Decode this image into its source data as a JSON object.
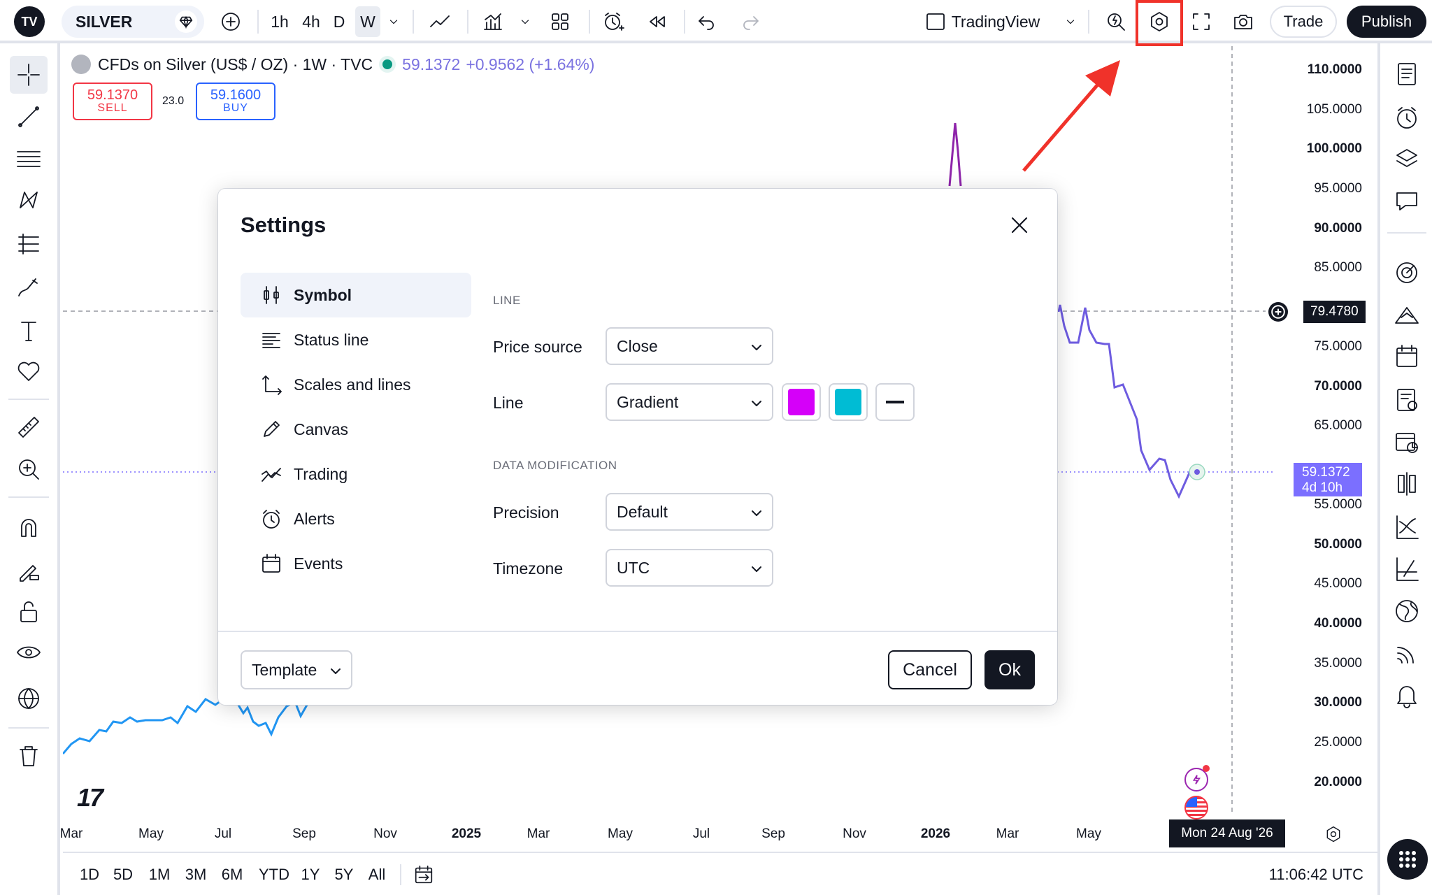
{
  "header": {
    "symbol": "SILVER",
    "timeframes": [
      "1h",
      "4h",
      "D",
      "W"
    ],
    "active_timeframe": "W",
    "layout_name": "TradingView",
    "trade_label": "Trade",
    "publish_label": "Publish",
    "logo_text": "TV"
  },
  "legend": {
    "title": "CFDs on Silver (US$ / OZ) · 1W · TVC",
    "last": "59.1372",
    "change": "+0.9562 (+1.64%)",
    "sell_price": "59.1370",
    "sell_label": "SELL",
    "spread": "23.0",
    "buy_price": "59.1600",
    "buy_label": "BUY"
  },
  "price_axis": {
    "labels": [
      "110.0000",
      "105.0000",
      "100.0000",
      "95.0000",
      "90.0000",
      "85.0000",
      "75.0000",
      "70.0000",
      "65.0000",
      "55.0000",
      "50.0000",
      "45.0000",
      "40.0000",
      "35.0000",
      "30.0000",
      "25.0000",
      "20.0000"
    ],
    "crosshair_price": "79.4780",
    "last_price": "59.1372",
    "countdown": "4d 10h"
  },
  "time_axis": {
    "labels": [
      "Mar",
      "May",
      "Jul",
      "Sep",
      "Nov",
      "2025",
      "Mar",
      "May",
      "Jul",
      "Sep",
      "Nov",
      "2026",
      "Mar",
      "May"
    ],
    "crosshair_date": "Mon 24 Aug '26"
  },
  "watermark": "17",
  "bottom_bar": {
    "ranges": [
      "1D",
      "5D",
      "1M",
      "3M",
      "6M",
      "YTD",
      "1Y",
      "5Y",
      "All"
    ],
    "clock": "11:06:42 UTC"
  },
  "dialog": {
    "title": "Settings",
    "nav": [
      "Symbol",
      "Status line",
      "Scales and lines",
      "Canvas",
      "Trading",
      "Alerts",
      "Events"
    ],
    "active_nav": "Symbol",
    "section_line": "LINE",
    "price_source_label": "Price source",
    "price_source_value": "Close",
    "line_label": "Line",
    "line_value": "Gradient",
    "gradient_color_1": "#d500f9",
    "gradient_color_2": "#00bcd4",
    "section_data": "DATA MODIFICATION",
    "precision_label": "Precision",
    "precision_value": "Default",
    "timezone_label": "Timezone",
    "timezone_value": "UTC",
    "template_label": "Template",
    "cancel_label": "Cancel",
    "ok_label": "Ok"
  },
  "colors": {
    "line_gradient_start": "#2196f3",
    "line_gradient_end": "#7b1fa2",
    "highlight": "#f0322a",
    "last_price_tag": "#7b6fff"
  }
}
